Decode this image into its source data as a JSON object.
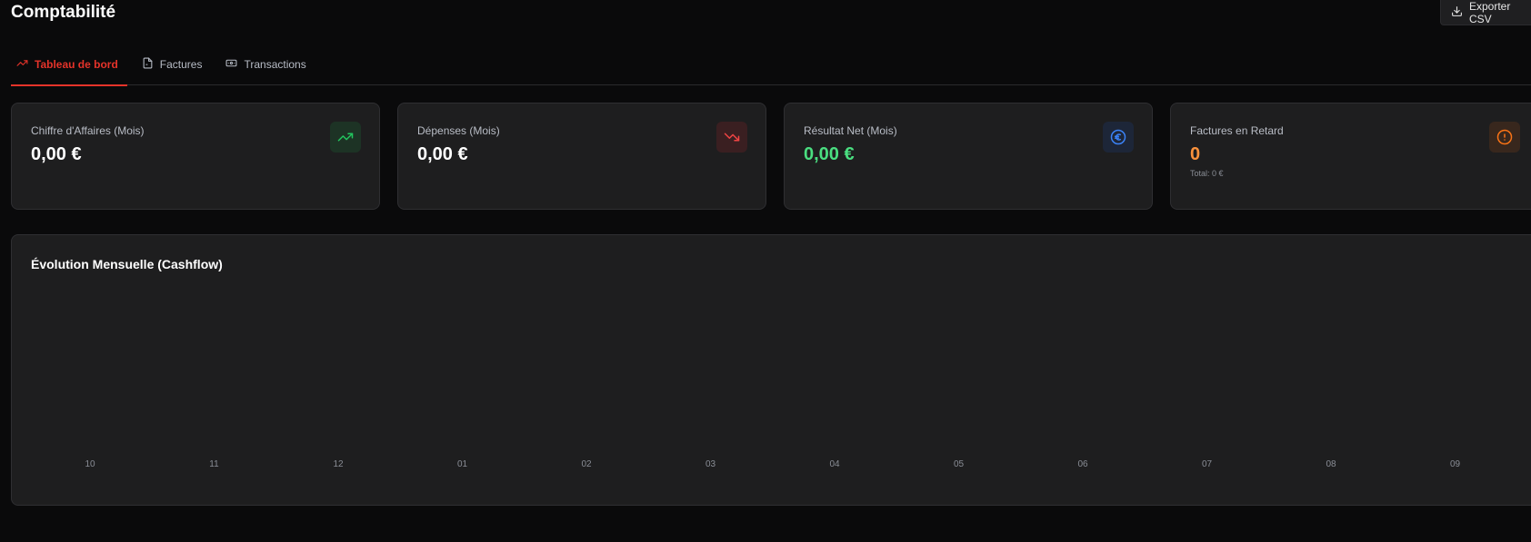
{
  "header": {
    "title": "Comptabilité",
    "export_label": "Exporter CSV"
  },
  "tabs": [
    {
      "label": "Tableau de bord",
      "icon": "trending-up-icon",
      "active": true
    },
    {
      "label": "Factures",
      "icon": "file-icon",
      "active": false
    },
    {
      "label": "Transactions",
      "icon": "banknote-icon",
      "active": false
    }
  ],
  "cards": [
    {
      "label": "Chiffre d'Affaires (Mois)",
      "value": "0,00 €",
      "icon": "trending-up-icon",
      "accent": "#22c55e"
    },
    {
      "label": "Dépenses (Mois)",
      "value": "0,00 €",
      "icon": "trending-down-icon",
      "accent": "#ef4444"
    },
    {
      "label": "Résultat Net (Mois)",
      "value": "0,00 €",
      "icon": "euro-icon",
      "accent": "#3b82f6",
      "value_color": "#4ade80"
    },
    {
      "label": "Factures en Retard",
      "value": "0",
      "sub": "Total: 0 €",
      "icon": "alert-circle-icon",
      "accent": "#f97316",
      "value_color": "#fb923c"
    }
  ],
  "chart": {
    "title": "Évolution Mensuelle (Cashflow)"
  },
  "chart_data": {
    "type": "bar",
    "title": "Évolution Mensuelle (Cashflow)",
    "categories": [
      "10",
      "11",
      "12",
      "01",
      "02",
      "03",
      "04",
      "05",
      "06",
      "07",
      "08",
      "09"
    ],
    "series": [],
    "grid": false
  }
}
